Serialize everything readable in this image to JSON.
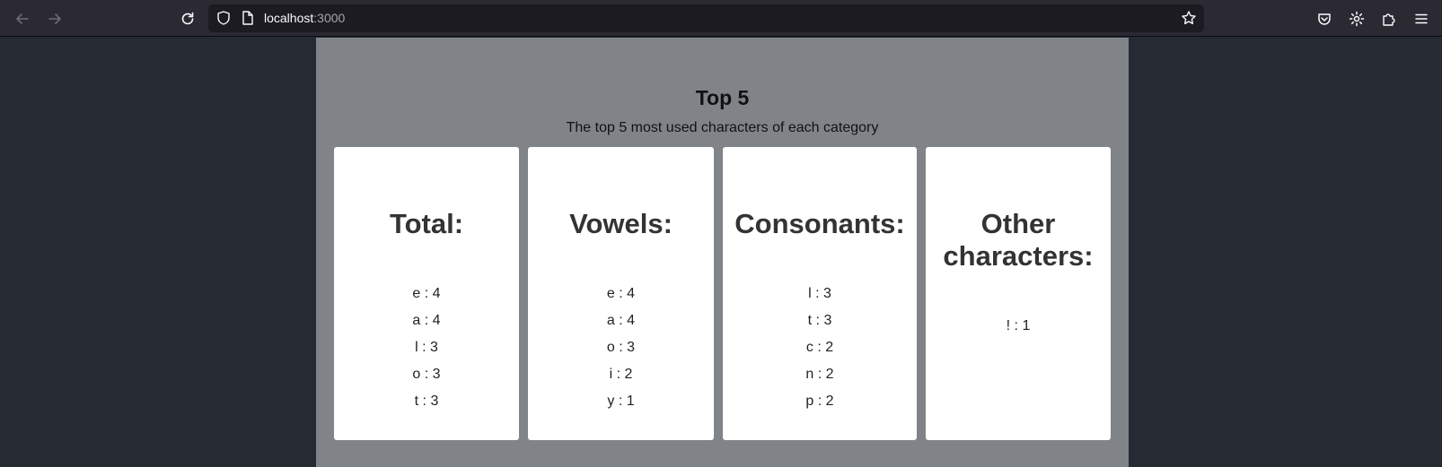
{
  "browser": {
    "url_host": "localhost",
    "url_port": ":3000"
  },
  "page": {
    "title": "Top 5",
    "subtitle": "The top 5 most used characters of each category",
    "cards": [
      {
        "title": "Total:",
        "items": [
          "e : 4",
          "a : 4",
          "l : 3",
          "o : 3",
          "t : 3"
        ]
      },
      {
        "title": "Vowels:",
        "items": [
          "e : 4",
          "a : 4",
          "o : 3",
          "i : 2",
          "y : 1"
        ]
      },
      {
        "title": "Consonants:",
        "items": [
          "l : 3",
          "t : 3",
          "c : 2",
          "n : 2",
          "p : 2"
        ]
      },
      {
        "title_line1": "Other",
        "title_line2": "characters:",
        "items": [
          "! : 1"
        ]
      }
    ]
  }
}
